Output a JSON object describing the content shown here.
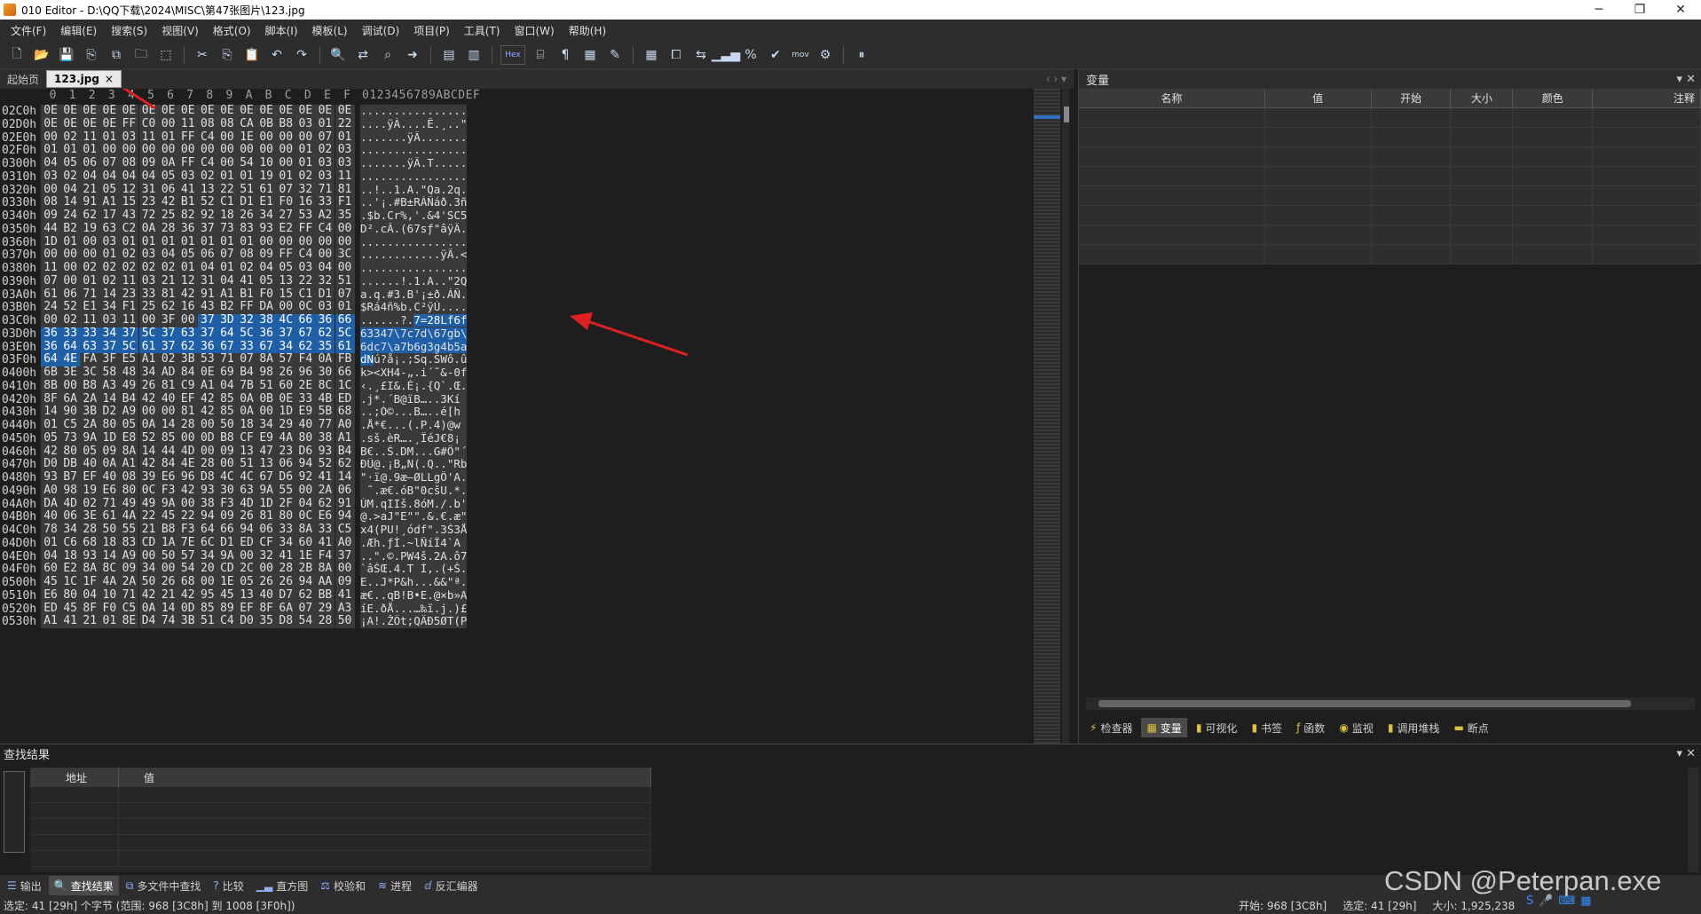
{
  "window": {
    "title": "010 Editor - D:\\QQ下载\\2024\\MISC\\第47张图片\\123.jpg",
    "controls": [
      "─",
      "❐",
      "✕"
    ]
  },
  "menu": [
    "文件(F)",
    "编辑(E)",
    "搜索(S)",
    "视图(V)",
    "格式(O)",
    "脚本(I)",
    "模板(L)",
    "调试(D)",
    "项目(P)",
    "工具(T)",
    "窗口(W)",
    "帮助(H)"
  ],
  "toolbar": {
    "hex_label": "Hex",
    "mov_label": "mov"
  },
  "tabs": [
    {
      "label": "起始页",
      "active": false
    },
    {
      "label": "123.jpg",
      "active": true,
      "close": "×"
    }
  ],
  "hex": {
    "columns": [
      "0",
      "1",
      "2",
      "3",
      "4",
      "5",
      "6",
      "7",
      "8",
      "9",
      "A",
      "B",
      "C",
      "D",
      "E",
      "F"
    ],
    "ascii_header": "0123456789ABCDEF",
    "rows": [
      {
        "addr": "02C0h",
        "bytes": [
          "0E",
          "0E",
          "0E",
          "0E",
          "0E",
          "0E",
          "0E",
          "0E",
          "0E",
          "0E",
          "0E",
          "0E",
          "0E",
          "0E",
          "0E",
          "0E"
        ],
        "ascii": "................"
      },
      {
        "addr": "02D0h",
        "bytes": [
          "0E",
          "0E",
          "0E",
          "0E",
          "FF",
          "C0",
          "00",
          "11",
          "08",
          "08",
          "CA",
          "0B",
          "B8",
          "03",
          "01",
          "22"
        ],
        "ascii": "....ÿÀ....Ê.¸..\""
      },
      {
        "addr": "02E0h",
        "bytes": [
          "00",
          "02",
          "11",
          "01",
          "03",
          "11",
          "01",
          "FF",
          "C4",
          "00",
          "1E",
          "00",
          "00",
          "00",
          "07",
          "01"
        ],
        "ascii": ".......ÿÄ......."
      },
      {
        "addr": "02F0h",
        "bytes": [
          "01",
          "01",
          "01",
          "00",
          "00",
          "00",
          "00",
          "00",
          "00",
          "00",
          "00",
          "00",
          "00",
          "01",
          "02",
          "03"
        ],
        "ascii": "................"
      },
      {
        "addr": "0300h",
        "bytes": [
          "04",
          "05",
          "06",
          "07",
          "08",
          "09",
          "0A",
          "FF",
          "C4",
          "00",
          "54",
          "10",
          "00",
          "01",
          "03",
          "03"
        ],
        "ascii": ".......ÿÄ.T....."
      },
      {
        "addr": "0310h",
        "bytes": [
          "03",
          "02",
          "04",
          "04",
          "04",
          "04",
          "05",
          "03",
          "02",
          "01",
          "01",
          "19",
          "01",
          "02",
          "03",
          "11"
        ],
        "ascii": "................"
      },
      {
        "addr": "0320h",
        "bytes": [
          "00",
          "04",
          "21",
          "05",
          "12",
          "31",
          "06",
          "41",
          "13",
          "22",
          "51",
          "61",
          "07",
          "32",
          "71",
          "81"
        ],
        "ascii": "..!..1.A.\"Qa.2q."
      },
      {
        "addr": "0330h",
        "bytes": [
          "08",
          "14",
          "91",
          "A1",
          "15",
          "23",
          "42",
          "B1",
          "52",
          "C1",
          "D1",
          "E1",
          "F0",
          "16",
          "33",
          "F1"
        ],
        "ascii": "..'¡.#B±RÁÑáð.3ñ"
      },
      {
        "addr": "0340h",
        "bytes": [
          "09",
          "24",
          "62",
          "17",
          "43",
          "72",
          "25",
          "82",
          "92",
          "18",
          "26",
          "34",
          "27",
          "53",
          "A2",
          "35"
        ],
        "ascii": ".$b.Cr%,'.&4'SC5"
      },
      {
        "addr": "0350h",
        "bytes": [
          "44",
          "B2",
          "19",
          "63",
          "C2",
          "0A",
          "28",
          "36",
          "37",
          "73",
          "83",
          "93",
          "E2",
          "FF",
          "C4",
          "00"
        ],
        "ascii": "D².cÂ.(67sƒ\"âÿÄ."
      },
      {
        "addr": "0360h",
        "bytes": [
          "1D",
          "01",
          "00",
          "03",
          "01",
          "01",
          "01",
          "01",
          "01",
          "01",
          "01",
          "00",
          "00",
          "00",
          "00",
          "00"
        ],
        "ascii": "................"
      },
      {
        "addr": "0370h",
        "bytes": [
          "00",
          "00",
          "00",
          "01",
          "02",
          "03",
          "04",
          "05",
          "06",
          "07",
          "08",
          "09",
          "FF",
          "C4",
          "00",
          "3C"
        ],
        "ascii": "............ÿÄ.<"
      },
      {
        "addr": "0380h",
        "bytes": [
          "11",
          "00",
          "02",
          "02",
          "02",
          "02",
          "02",
          "01",
          "04",
          "01",
          "02",
          "04",
          "05",
          "03",
          "04",
          "00"
        ],
        "ascii": "................"
      },
      {
        "addr": "0390h",
        "bytes": [
          "07",
          "00",
          "01",
          "02",
          "11",
          "03",
          "21",
          "12",
          "31",
          "04",
          "41",
          "05",
          "13",
          "22",
          "32",
          "51"
        ],
        "ascii": "......!.1.A..\"2Q"
      },
      {
        "addr": "03A0h",
        "bytes": [
          "61",
          "06",
          "71",
          "14",
          "23",
          "33",
          "81",
          "42",
          "91",
          "A1",
          "B1",
          "F0",
          "15",
          "C1",
          "D1",
          "07"
        ],
        "ascii": "a.q.#3.B'¡±ð.ÁÑ."
      },
      {
        "addr": "03B0h",
        "bytes": [
          "24",
          "52",
          "E1",
          "34",
          "F1",
          "25",
          "62",
          "16",
          "43",
          "B2",
          "FF",
          "DA",
          "00",
          "0C",
          "03",
          "01"
        ],
        "ascii": "$Rá4ñ%b.C²ÿÚ...."
      },
      {
        "addr": "03C0h",
        "bytes": [
          "00",
          "02",
          "11",
          "03",
          "11",
          "00",
          "3F",
          "00",
          "37",
          "3D",
          "32",
          "38",
          "4C",
          "66",
          "36",
          "66"
        ],
        "ascii": "......?.7=28Lf6f",
        "sel_from": 8
      },
      {
        "addr": "03D0h",
        "bytes": [
          "36",
          "33",
          "33",
          "34",
          "37",
          "5C",
          "37",
          "63",
          "37",
          "64",
          "5C",
          "36",
          "37",
          "67",
          "62",
          "5C"
        ],
        "ascii": "63347\\7c7d\\67gb\\",
        "sel_from": 0
      },
      {
        "addr": "03E0h",
        "bytes": [
          "36",
          "64",
          "63",
          "37",
          "5C",
          "61",
          "37",
          "62",
          "36",
          "67",
          "33",
          "67",
          "34",
          "62",
          "35",
          "61"
        ],
        "ascii": "6dc7\\a7b6g3g4b5a",
        "sel_from": 0
      },
      {
        "addr": "03F0h",
        "bytes": [
          "64",
          "4E",
          "FA",
          "3F",
          "E5",
          "A1",
          "02",
          "3B",
          "53",
          "71",
          "07",
          "8A",
          "57",
          "F4",
          "0A",
          "FB"
        ],
        "ascii": "dNú?å¡.;Sq.ŠWô.û",
        "sel_to": 1
      },
      {
        "addr": "0400h",
        "bytes": [
          "6B",
          "3E",
          "3C",
          "58",
          "48",
          "34",
          "AD",
          "84",
          "0E",
          "69",
          "B4",
          "98",
          "26",
          "96",
          "30",
          "66"
        ],
        "ascii": "k><XH4-„.i´˜&-0f"
      },
      {
        "addr": "0410h",
        "bytes": [
          "8B",
          "00",
          "B8",
          "A3",
          "49",
          "26",
          "81",
          "C9",
          "A1",
          "04",
          "7B",
          "51",
          "60",
          "2E",
          "8C",
          "1C"
        ],
        "ascii": "‹.¸£I&.É¡.{Q`.Œ."
      },
      {
        "addr": "0420h",
        "bytes": [
          "8F",
          "6A",
          "2A",
          "14",
          "B4",
          "42",
          "40",
          "EF",
          "42",
          "85",
          "0A",
          "0B",
          "0E",
          "33",
          "4B",
          "ED"
        ],
        "ascii": ".j*.´B@ïB…..3Kí"
      },
      {
        "addr": "0430h",
        "bytes": [
          "14",
          "90",
          "3B",
          "D2",
          "A9",
          "00",
          "00",
          "81",
          "42",
          "85",
          "0A",
          "00",
          "1D",
          "E9",
          "5B",
          "68"
        ],
        "ascii": "..;Ò©...B…..é[h"
      },
      {
        "addr": "0440h",
        "bytes": [
          "01",
          "C5",
          "2A",
          "80",
          "05",
          "0A",
          "14",
          "28",
          "00",
          "50",
          "18",
          "34",
          "29",
          "40",
          "77",
          "A0"
        ],
        "ascii": ".Å*€...(.P.4)@w "
      },
      {
        "addr": "0450h",
        "bytes": [
          "05",
          "73",
          "9A",
          "1D",
          "E8",
          "52",
          "85",
          "00",
          "0D",
          "B8",
          "CF",
          "E9",
          "4A",
          "80",
          "38",
          "A1"
        ],
        "ascii": ".sš.èR….¸ÏéJ€8¡"
      },
      {
        "addr": "0460h",
        "bytes": [
          "42",
          "80",
          "05",
          "09",
          "8A",
          "14",
          "44",
          "4D",
          "00",
          "09",
          "13",
          "47",
          "23",
          "D6",
          "93",
          "B4"
        ],
        "ascii": "B€..Š.DM...G#Ö\"´"
      },
      {
        "addr": "0470h",
        "bytes": [
          "D0",
          "DB",
          "40",
          "0A",
          "A1",
          "42",
          "84",
          "4E",
          "28",
          "00",
          "51",
          "13",
          "06",
          "94",
          "52",
          "62"
        ],
        "ascii": "ÐÛ@.¡B„N(.Q..\"Rb"
      },
      {
        "addr": "0480h",
        "bytes": [
          "93",
          "B7",
          "EF",
          "40",
          "08",
          "39",
          "E6",
          "96",
          "D8",
          "4C",
          "4C",
          "67",
          "D6",
          "92",
          "41",
          "14"
        ],
        "ascii": "\"·ï@.9æ–ØLLgÖ'A."
      },
      {
        "addr": "0490h",
        "bytes": [
          "A0",
          "98",
          "19",
          "E6",
          "80",
          "0C",
          "F3",
          "42",
          "93",
          "30",
          "63",
          "9A",
          "55",
          "00",
          "2A",
          "06"
        ],
        "ascii": " ˜.æ€.óB\"0cšU.*."
      },
      {
        "addr": "04A0h",
        "bytes": [
          "DA",
          "4D",
          "02",
          "71",
          "49",
          "49",
          "9A",
          "00",
          "38",
          "F3",
          "4D",
          "1D",
          "2F",
          "04",
          "62",
          "91"
        ],
        "ascii": "ÚM.qIIš.8óM./.b'"
      },
      {
        "addr": "04B0h",
        "bytes": [
          "40",
          "06",
          "3E",
          "61",
          "4A",
          "22",
          "45",
          "22",
          "94",
          "09",
          "26",
          "81",
          "80",
          "0C",
          "E6",
          "94"
        ],
        "ascii": "@.>aJ\"E\"\".&.€.æ\""
      },
      {
        "addr": "04C0h",
        "bytes": [
          "78",
          "34",
          "28",
          "50",
          "55",
          "21",
          "B8",
          "F3",
          "64",
          "66",
          "94",
          "06",
          "33",
          "8A",
          "33",
          "C5"
        ],
        "ascii": "x4(PU!¸ódf\".3Š3Å"
      },
      {
        "addr": "04D0h",
        "bytes": [
          "01",
          "C6",
          "68",
          "18",
          "83",
          "CD",
          "1A",
          "7E",
          "6C",
          "D1",
          "ED",
          "CF",
          "34",
          "60",
          "41",
          "A0"
        ],
        "ascii": ".Æh.ƒÍ.~lÑíÏ4`A "
      },
      {
        "addr": "04E0h",
        "bytes": [
          "04",
          "18",
          "93",
          "14",
          "A9",
          "00",
          "50",
          "57",
          "34",
          "9A",
          "00",
          "32",
          "41",
          "1E",
          "F4",
          "37"
        ],
        "ascii": "..\".©.PW4š.2A.ô7"
      },
      {
        "addr": "04F0h",
        "bytes": [
          "60",
          "E2",
          "8A",
          "8C",
          "09",
          "34",
          "00",
          "54",
          "20",
          "CD",
          "2C",
          "00",
          "28",
          "2B",
          "8A",
          "00"
        ],
        "ascii": "`âŠŒ.4.T Í,.(+Š."
      },
      {
        "addr": "0500h",
        "bytes": [
          "45",
          "1C",
          "1F",
          "4A",
          "2A",
          "50",
          "26",
          "68",
          "00",
          "1E",
          "05",
          "26",
          "26",
          "94",
          "AA",
          "09"
        ],
        "ascii": "E..J*P&h...&&\"ª."
      },
      {
        "addr": "0510h",
        "bytes": [
          "E6",
          "80",
          "04",
          "10",
          "71",
          "42",
          "21",
          "42",
          "95",
          "45",
          "13",
          "40",
          "D7",
          "62",
          "BB",
          "41"
        ],
        "ascii": "æ€..qB!B•E.@×b»A"
      },
      {
        "addr": "0520h",
        "bytes": [
          "ED",
          "45",
          "8F",
          "F0",
          "C5",
          "0A",
          "14",
          "0D",
          "85",
          "89",
          "EF",
          "8F",
          "6A",
          "07",
          "29",
          "A3"
        ],
        "ascii": "íE.ðÅ...…‰ï.j.)£"
      },
      {
        "addr": "0530h",
        "bytes": [
          "A1",
          "41",
          "21",
          "01",
          "8E",
          "D4",
          "74",
          "3B",
          "51",
          "C4",
          "D0",
          "35",
          "D8",
          "54",
          "28",
          "50"
        ],
        "ascii": "¡A!.ŽÔt;QÄÐ5ØT(P"
      }
    ]
  },
  "variables": {
    "title": "变量",
    "columns": [
      "名称",
      "值",
      "开始",
      "大小",
      "颜色",
      "注释"
    ],
    "tabs": [
      {
        "label": "检查器",
        "icon": "⚡",
        "active": false
      },
      {
        "label": "变量",
        "icon": "▦",
        "active": true
      },
      {
        "label": "可视化",
        "icon": "▮",
        "active": false
      },
      {
        "label": "书签",
        "icon": "▮",
        "active": false
      },
      {
        "label": "函数",
        "icon": "ƒ",
        "active": false
      },
      {
        "label": "监视",
        "icon": "◉",
        "active": false
      },
      {
        "label": "调用堆栈",
        "icon": "▮",
        "active": false
      },
      {
        "label": "断点",
        "icon": "▬",
        "active": false
      }
    ]
  },
  "find": {
    "title": "查找结果",
    "columns": [
      "地址",
      "值"
    ]
  },
  "bottom_tabs": [
    {
      "label": "输出",
      "active": false
    },
    {
      "label": "查找结果",
      "active": true
    },
    {
      "label": "多文件中查找",
      "active": false
    },
    {
      "label": "比较",
      "active": false
    },
    {
      "label": "直方图",
      "active": false
    },
    {
      "label": "校验和",
      "active": false
    },
    {
      "label": "进程",
      "active": false
    },
    {
      "label": "反汇编器",
      "active": false
    }
  ],
  "status": {
    "left": "选定: 41 [29h] 个字节 (范围: 968 [3C8h] 到 1008 [3F0h])",
    "start": "开始: 968 [3C8h]",
    "selected": "选定: 41 [29h]",
    "size": "大小: 1,925,238"
  },
  "watermark": "CSDN @Peterpan.exe"
}
